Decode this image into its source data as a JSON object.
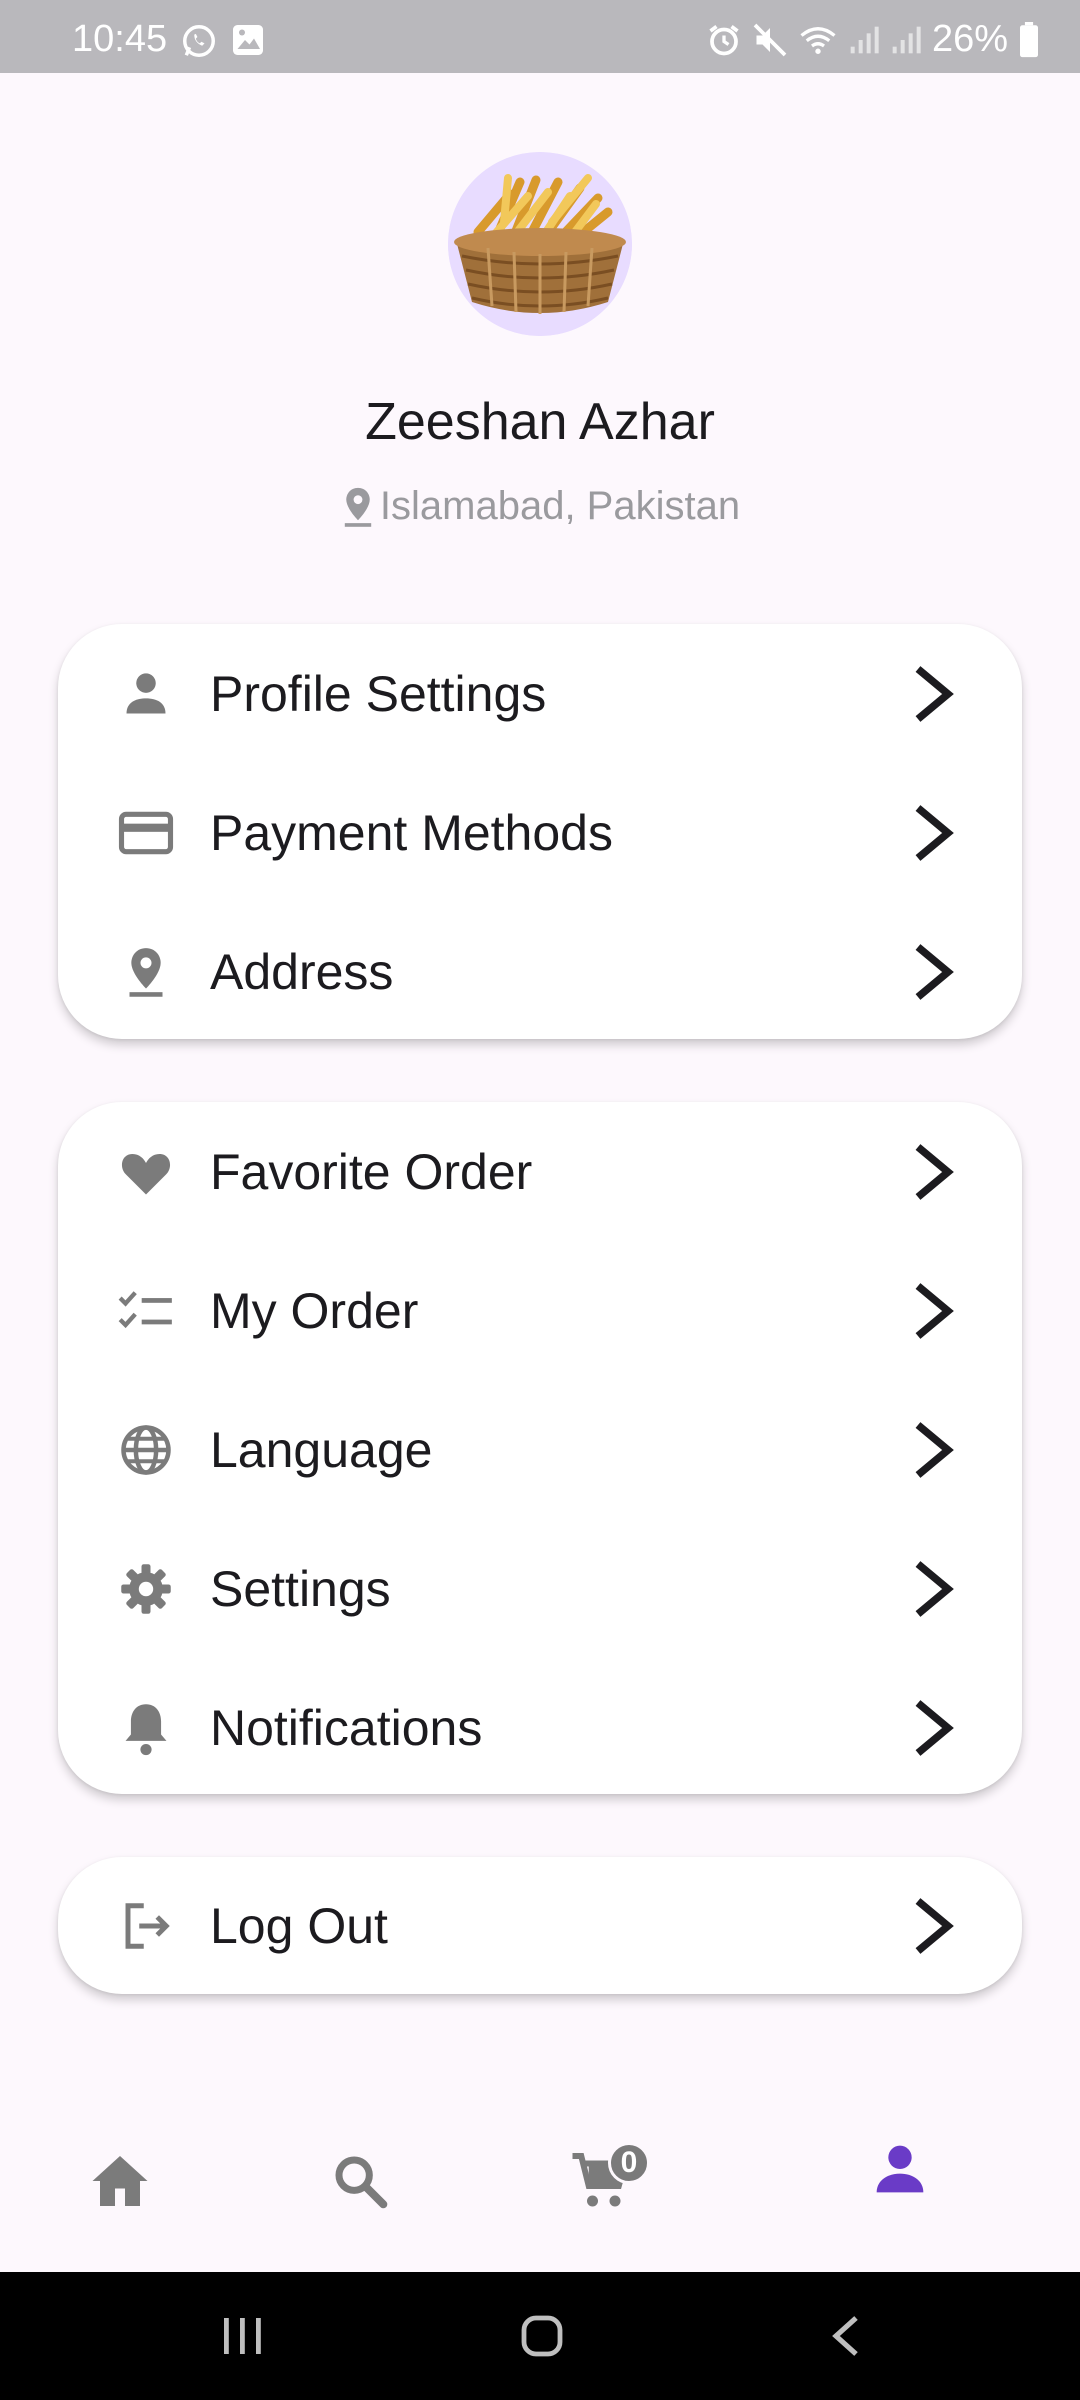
{
  "status_bar": {
    "time": "10:45",
    "battery": "26%",
    "left_icons": [
      "whatsapp-icon",
      "image-icon"
    ],
    "right_icons": [
      "alarm-icon",
      "mute-icon",
      "wifi-icon",
      "signal-icon",
      "signal-icon",
      "battery-icon"
    ]
  },
  "profile": {
    "name": "Zeeshan Azhar",
    "location": "Islamabad, Pakistan",
    "avatar": "fries-basket-image"
  },
  "menu_group_1": [
    {
      "label": "Profile Settings",
      "icon": "person-icon"
    },
    {
      "label": "Payment Methods",
      "icon": "credit-card-icon"
    },
    {
      "label": "Address",
      "icon": "location-pin-icon"
    }
  ],
  "menu_group_2": [
    {
      "label": "Favorite Order",
      "icon": "heart-icon"
    },
    {
      "label": "My Order",
      "icon": "checklist-icon"
    },
    {
      "label": "Language",
      "icon": "globe-icon"
    },
    {
      "label": "Settings",
      "icon": "gear-icon"
    },
    {
      "label": "Notifications",
      "icon": "bell-icon"
    }
  ],
  "menu_group_3": [
    {
      "label": "Log Out",
      "icon": "logout-icon"
    }
  ],
  "bottom_nav": {
    "items": [
      "home-icon",
      "search-icon",
      "cart-icon",
      "person-icon"
    ],
    "active": "person-icon",
    "cart_count": "0"
  },
  "colors": {
    "accent": "#6a3bc7",
    "icon_gray": "#7b7b7b",
    "background": "#fdf8fd",
    "card": "#ffffff",
    "status_bar": "#b9b8bc"
  }
}
